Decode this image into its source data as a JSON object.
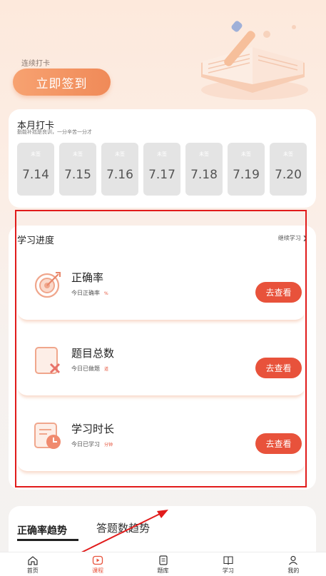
{
  "hero": {
    "streak_label": "连续打卡",
    "checkin_button": "立即签到"
  },
  "month": {
    "title": "本月打卡",
    "subtitle": "勤能补拙是良训，一分辛苦一分才",
    "days": [
      {
        "status": "未签",
        "date": "7.14",
        "weekday": "周一"
      },
      {
        "status": "未签",
        "date": "7.15",
        "weekday": "周二"
      },
      {
        "status": "未签",
        "date": "7.16",
        "weekday": "周三"
      },
      {
        "status": "未签",
        "date": "7.17",
        "weekday": "周四"
      },
      {
        "status": "未签",
        "date": "7.18",
        "weekday": "周五"
      },
      {
        "status": "未签",
        "date": "7.19",
        "weekday": "周六"
      },
      {
        "status": "未签",
        "date": "7.20",
        "weekday": "周日"
      }
    ]
  },
  "progress": {
    "title": "学习进度",
    "continue": "继续学习 ❯",
    "items": [
      {
        "title": "正确率",
        "sub": "今日正确率",
        "unit": "%",
        "button": "去查看",
        "icon": "target-icon"
      },
      {
        "title": "题目总数",
        "sub": "今日已做题",
        "unit": "道",
        "button": "去查看",
        "icon": "question-total-icon"
      },
      {
        "title": "学习时长",
        "sub": "今日已学习",
        "unit": "分钟",
        "button": "去查看",
        "icon": "study-time-icon"
      }
    ]
  },
  "trend": {
    "tab_accuracy": "正确率趋势",
    "tab_count": "答题数趋势"
  },
  "nav": [
    {
      "label": "首页",
      "icon": "home-icon"
    },
    {
      "label": "课程",
      "icon": "course-play-icon"
    },
    {
      "label": "题库",
      "icon": "question-bank-icon"
    },
    {
      "label": "学习",
      "icon": "book-icon"
    },
    {
      "label": "我的",
      "icon": "user-icon"
    }
  ],
  "colors": {
    "accent": "#e8523b",
    "highlight": "#e11b1b",
    "button_gradient_start": "#f7a271",
    "button_gradient_end": "#f08a58"
  }
}
